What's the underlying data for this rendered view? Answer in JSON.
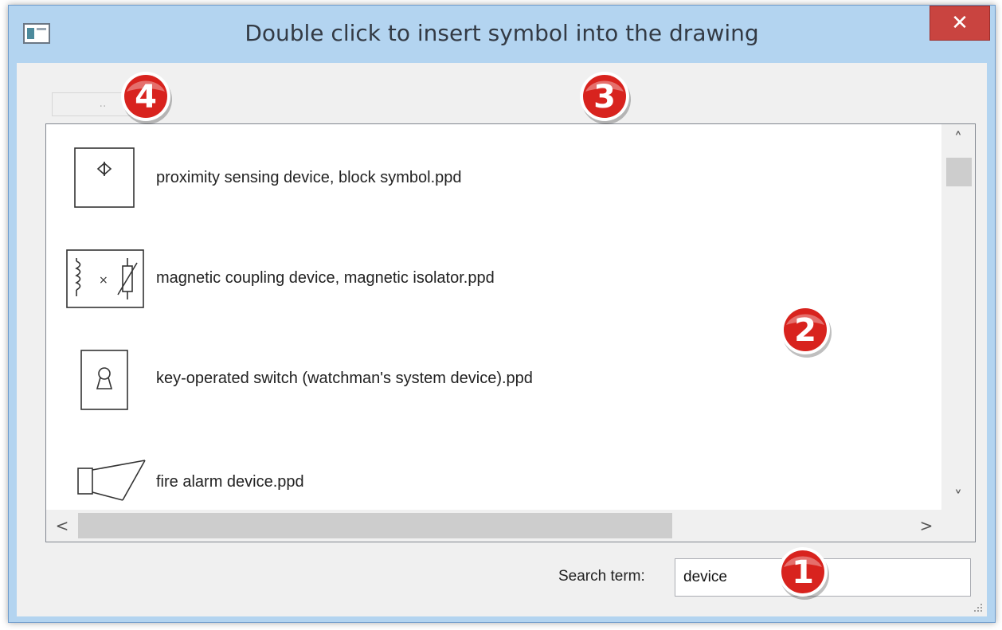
{
  "window": {
    "title": "Double click to insert symbol into the drawing",
    "close_label": "✕"
  },
  "toolbar": {
    "up_label": ".."
  },
  "list": {
    "items": [
      {
        "label": "proximity sensing device, block symbol.ppd",
        "icon": "proximity-sensing-symbol-icon"
      },
      {
        "label": "magnetic coupling device, magnetic isolator.ppd",
        "icon": "magnetic-isolator-symbol-icon"
      },
      {
        "label": "key-operated switch (watchman's system device).ppd",
        "icon": "key-switch-symbol-icon"
      },
      {
        "label": "fire alarm device.ppd",
        "icon": "fire-alarm-symbol-icon"
      }
    ]
  },
  "scroll": {
    "up_arrow": "˄",
    "down_arrow": "˅",
    "left_arrow": "<",
    "right_arrow": ">"
  },
  "search": {
    "label": "Search term:",
    "value": "device"
  },
  "callouts": [
    "1",
    "2",
    "3",
    "4"
  ],
  "colors": {
    "titlebar": "#b3d4f0",
    "close": "#c94440",
    "badge": "#d8231e"
  }
}
